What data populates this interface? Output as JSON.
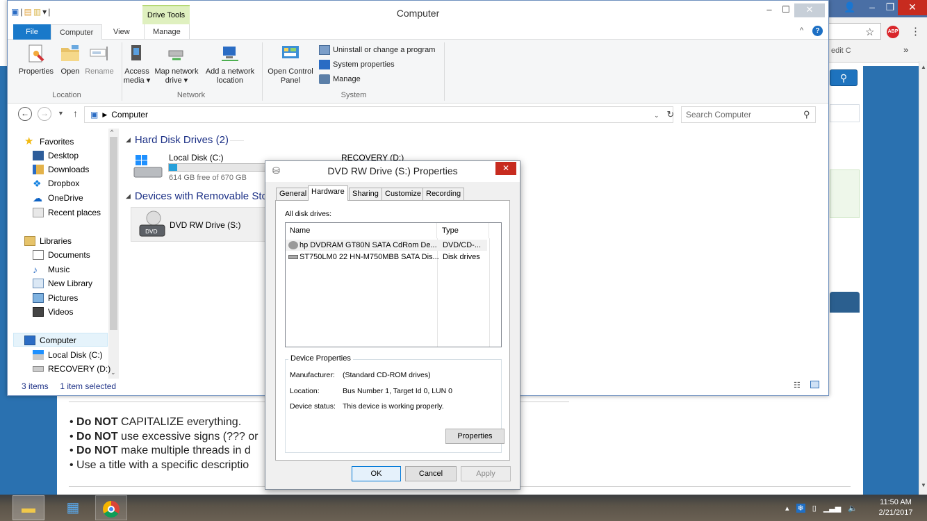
{
  "background_browser": {
    "edit_hint": "edit C",
    "rules": [
      {
        "bold": "Do NOT",
        "rest": " CAPITALIZE everything."
      },
      {
        "bold": "Do NOT",
        "rest": " use excessive signs (??? or"
      },
      {
        "bold": "Do NOT",
        "rest": " make multiple threads in d"
      },
      {
        "bold": "",
        "rest": "Use a title with a specific descriptio"
      }
    ]
  },
  "explorer": {
    "title": "Computer",
    "contextual_tab": "Drive Tools",
    "tabs": [
      "File",
      "Computer",
      "View",
      "Manage"
    ],
    "ribbon": {
      "location_buttons": [
        "Properties",
        "Open",
        "Rename"
      ],
      "location_group": "Location",
      "network_buttons": [
        {
          "line1": "Access",
          "line2": "media ▾"
        },
        {
          "line1": "Map network",
          "line2": "drive ▾"
        },
        {
          "line1": "Add a network",
          "line2": "location"
        }
      ],
      "network_group": "Network",
      "system_button": {
        "line1": "Open Control",
        "line2": "Panel"
      },
      "system_items": [
        "Uninstall or change a program",
        "System properties",
        "Manage"
      ],
      "system_group": "System"
    },
    "address": "Computer",
    "search_placeholder": "Search Computer",
    "nav": {
      "favorites": "Favorites",
      "favorites_items": [
        "Desktop",
        "Downloads",
        "Dropbox",
        "OneDrive",
        "Recent places"
      ],
      "libraries": "Libraries",
      "libraries_items": [
        "Documents",
        "Music",
        "New Library",
        "Pictures",
        "Videos"
      ],
      "computer": "Computer",
      "computer_items": [
        "Local Disk (C:)",
        "RECOVERY (D:)"
      ]
    },
    "content": {
      "hdd_group": "Hard Disk Drives (2)",
      "drive_c_name": "Local Disk (C:)",
      "drive_c_free": "614 GB free of 670 GB",
      "drive_c_used_fraction": 0.084,
      "drive_d_name": "RECOVERY (D:)",
      "removable_group": "Devices with Removable Stor",
      "dvd_name": "DVD RW Drive (S:)",
      "dvd_label": "DVD"
    },
    "status": {
      "items": "3 items",
      "selected": "1 item selected"
    }
  },
  "dialog": {
    "title": "DVD RW Drive (S:) Properties",
    "tabs": [
      "General",
      "Hardware",
      "Sharing",
      "Customize",
      "Recording"
    ],
    "all_disk_drives": "All disk drives:",
    "col_name": "Name",
    "col_type": "Type",
    "drives": [
      {
        "name": "hp DVDRAM GT80N SATA CdRom De...",
        "type": "DVD/CD-..."
      },
      {
        "name": "ST750LM0 22 HN-M750MBB SATA Dis...",
        "type": "Disk drives"
      }
    ],
    "device_properties": "Device Properties",
    "manufacturer_label": "Manufacturer:",
    "manufacturer_value": "(Standard CD-ROM drives)",
    "location_label": "Location:",
    "location_value": "Bus Number 1, Target Id 0, LUN 0",
    "status_label": "Device status:",
    "status_value": "This device is working properly.",
    "properties_btn": "Properties",
    "ok": "OK",
    "cancel": "Cancel",
    "apply": "Apply"
  },
  "taskbar": {
    "clock_time": "11:50 AM",
    "clock_date": "2/21/2017"
  }
}
